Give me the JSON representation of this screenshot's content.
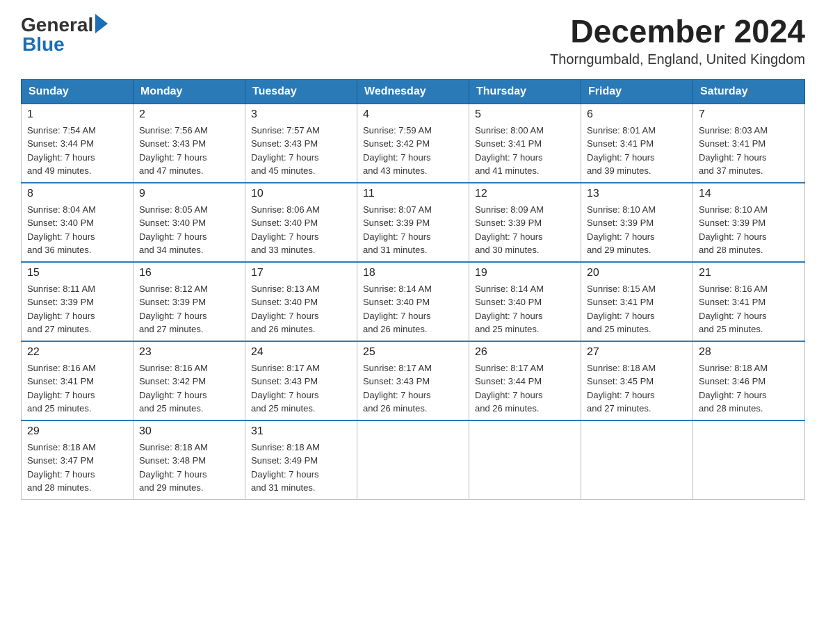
{
  "header": {
    "logo_general": "General",
    "logo_blue": "Blue",
    "month_year": "December 2024",
    "location": "Thorngumbald, England, United Kingdom"
  },
  "days_of_week": [
    "Sunday",
    "Monday",
    "Tuesday",
    "Wednesday",
    "Thursday",
    "Friday",
    "Saturday"
  ],
  "weeks": [
    [
      {
        "day": "1",
        "sunrise": "7:54 AM",
        "sunset": "3:44 PM",
        "daylight": "7 hours and 49 minutes."
      },
      {
        "day": "2",
        "sunrise": "7:56 AM",
        "sunset": "3:43 PM",
        "daylight": "7 hours and 47 minutes."
      },
      {
        "day": "3",
        "sunrise": "7:57 AM",
        "sunset": "3:43 PM",
        "daylight": "7 hours and 45 minutes."
      },
      {
        "day": "4",
        "sunrise": "7:59 AM",
        "sunset": "3:42 PM",
        "daylight": "7 hours and 43 minutes."
      },
      {
        "day": "5",
        "sunrise": "8:00 AM",
        "sunset": "3:41 PM",
        "daylight": "7 hours and 41 minutes."
      },
      {
        "day": "6",
        "sunrise": "8:01 AM",
        "sunset": "3:41 PM",
        "daylight": "7 hours and 39 minutes."
      },
      {
        "day": "7",
        "sunrise": "8:03 AM",
        "sunset": "3:41 PM",
        "daylight": "7 hours and 37 minutes."
      }
    ],
    [
      {
        "day": "8",
        "sunrise": "8:04 AM",
        "sunset": "3:40 PM",
        "daylight": "7 hours and 36 minutes."
      },
      {
        "day": "9",
        "sunrise": "8:05 AM",
        "sunset": "3:40 PM",
        "daylight": "7 hours and 34 minutes."
      },
      {
        "day": "10",
        "sunrise": "8:06 AM",
        "sunset": "3:40 PM",
        "daylight": "7 hours and 33 minutes."
      },
      {
        "day": "11",
        "sunrise": "8:07 AM",
        "sunset": "3:39 PM",
        "daylight": "7 hours and 31 minutes."
      },
      {
        "day": "12",
        "sunrise": "8:09 AM",
        "sunset": "3:39 PM",
        "daylight": "7 hours and 30 minutes."
      },
      {
        "day": "13",
        "sunrise": "8:10 AM",
        "sunset": "3:39 PM",
        "daylight": "7 hours and 29 minutes."
      },
      {
        "day": "14",
        "sunrise": "8:10 AM",
        "sunset": "3:39 PM",
        "daylight": "7 hours and 28 minutes."
      }
    ],
    [
      {
        "day": "15",
        "sunrise": "8:11 AM",
        "sunset": "3:39 PM",
        "daylight": "7 hours and 27 minutes."
      },
      {
        "day": "16",
        "sunrise": "8:12 AM",
        "sunset": "3:39 PM",
        "daylight": "7 hours and 27 minutes."
      },
      {
        "day": "17",
        "sunrise": "8:13 AM",
        "sunset": "3:40 PM",
        "daylight": "7 hours and 26 minutes."
      },
      {
        "day": "18",
        "sunrise": "8:14 AM",
        "sunset": "3:40 PM",
        "daylight": "7 hours and 26 minutes."
      },
      {
        "day": "19",
        "sunrise": "8:14 AM",
        "sunset": "3:40 PM",
        "daylight": "7 hours and 25 minutes."
      },
      {
        "day": "20",
        "sunrise": "8:15 AM",
        "sunset": "3:41 PM",
        "daylight": "7 hours and 25 minutes."
      },
      {
        "day": "21",
        "sunrise": "8:16 AM",
        "sunset": "3:41 PM",
        "daylight": "7 hours and 25 minutes."
      }
    ],
    [
      {
        "day": "22",
        "sunrise": "8:16 AM",
        "sunset": "3:41 PM",
        "daylight": "7 hours and 25 minutes."
      },
      {
        "day": "23",
        "sunrise": "8:16 AM",
        "sunset": "3:42 PM",
        "daylight": "7 hours and 25 minutes."
      },
      {
        "day": "24",
        "sunrise": "8:17 AM",
        "sunset": "3:43 PM",
        "daylight": "7 hours and 25 minutes."
      },
      {
        "day": "25",
        "sunrise": "8:17 AM",
        "sunset": "3:43 PM",
        "daylight": "7 hours and 26 minutes."
      },
      {
        "day": "26",
        "sunrise": "8:17 AM",
        "sunset": "3:44 PM",
        "daylight": "7 hours and 26 minutes."
      },
      {
        "day": "27",
        "sunrise": "8:18 AM",
        "sunset": "3:45 PM",
        "daylight": "7 hours and 27 minutes."
      },
      {
        "day": "28",
        "sunrise": "8:18 AM",
        "sunset": "3:46 PM",
        "daylight": "7 hours and 28 minutes."
      }
    ],
    [
      {
        "day": "29",
        "sunrise": "8:18 AM",
        "sunset": "3:47 PM",
        "daylight": "7 hours and 28 minutes."
      },
      {
        "day": "30",
        "sunrise": "8:18 AM",
        "sunset": "3:48 PM",
        "daylight": "7 hours and 29 minutes."
      },
      {
        "day": "31",
        "sunrise": "8:18 AM",
        "sunset": "3:49 PM",
        "daylight": "7 hours and 31 minutes."
      },
      null,
      null,
      null,
      null
    ]
  ],
  "labels": {
    "sunrise": "Sunrise:",
    "sunset": "Sunset:",
    "daylight": "Daylight:"
  }
}
